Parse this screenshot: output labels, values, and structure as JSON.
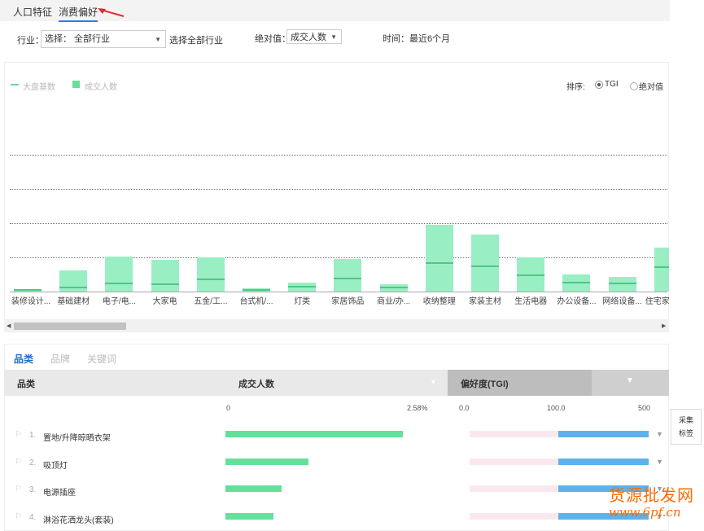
{
  "top_tabs": [
    {
      "label": "人口特征",
      "active": false
    },
    {
      "label": "消费偏好",
      "active": true
    }
  ],
  "filters": {
    "industry_label": "行业：",
    "industry_select": "选择：  全部行业",
    "industry_hint": "选择全部行业",
    "abs_label": "绝对值：",
    "abs_select": "成交人数",
    "time_text": "时间：最近6个月"
  },
  "chart_panel": {
    "legend": [
      {
        "label": "大盘基数",
        "marker": "line",
        "color": "#64e09a"
      },
      {
        "label": "成交人数",
        "marker": "box",
        "color": "#64e09a"
      }
    ],
    "sort_label": "排序:",
    "sort_options": [
      {
        "label": "TGI",
        "selected": true
      },
      {
        "label": "绝对值",
        "selected": false
      }
    ]
  },
  "chart_data": {
    "type": "bar",
    "categories": [
      "装修设计...",
      "基础建材",
      "电子/电...",
      "大家电",
      "五金/工...",
      "台式机/...",
      "灯类",
      "家居饰品",
      "商业/办...",
      "收纳整理",
      "家装主材",
      "生活电器",
      "办公设备...",
      "网络设备...",
      "住宅家..."
    ],
    "values": [
      3,
      26,
      43,
      39,
      42,
      4,
      11,
      40,
      9,
      82,
      70,
      42,
      21,
      18,
      54
    ],
    "base_values": [
      1,
      4,
      9,
      8,
      14,
      1,
      5,
      15,
      4,
      34,
      30,
      19,
      10,
      9,
      29
    ],
    "ylim": [
      0,
      100
    ],
    "grid": true,
    "bar_color": "#9aeec4",
    "base_color": "#50c784"
  },
  "sub_tabs": [
    {
      "label": "品类",
      "active": true
    },
    {
      "label": "品牌",
      "active": false
    },
    {
      "label": "关键词",
      "active": false
    }
  ],
  "table": {
    "headers": {
      "category": "品类",
      "deals": "成交人数",
      "tgi": "偏好度(TGI)"
    },
    "deals_axis": {
      "min": "0",
      "max": "2.58%"
    },
    "tgi_axis": {
      "min": "0.0",
      "mid": "100.0",
      "max": "500"
    },
    "rows": [
      {
        "rank": "1.",
        "name": "置地/升降晾晒衣架",
        "share": 0.85,
        "tgi_pink": 0.49,
        "tgi_blue": 0.5
      },
      {
        "rank": "2.",
        "name": "吸顶灯",
        "share": 0.4,
        "tgi_pink": 0.49,
        "tgi_blue": 0.5
      },
      {
        "rank": "3.",
        "name": "电源插座",
        "share": 0.27,
        "tgi_pink": 0.49,
        "tgi_blue": 0.5
      },
      {
        "rank": "4.",
        "name": "淋浴花洒龙头(套装)",
        "share": 0.23,
        "tgi_pink": 0.49,
        "tgi_blue": 0.5
      }
    ]
  },
  "side_panel": {
    "line1": "采集",
    "line2": "标签"
  },
  "watermark": {
    "line1": "货源批发网",
    "line2": "www.6pf.cn"
  },
  "colors": {
    "accent": "#1f6fd1",
    "bar": "#64e09a",
    "tgi_blue": "#5db2ec",
    "tgi_pink": "#fbe8ef",
    "arrow": "#e52b2b"
  }
}
